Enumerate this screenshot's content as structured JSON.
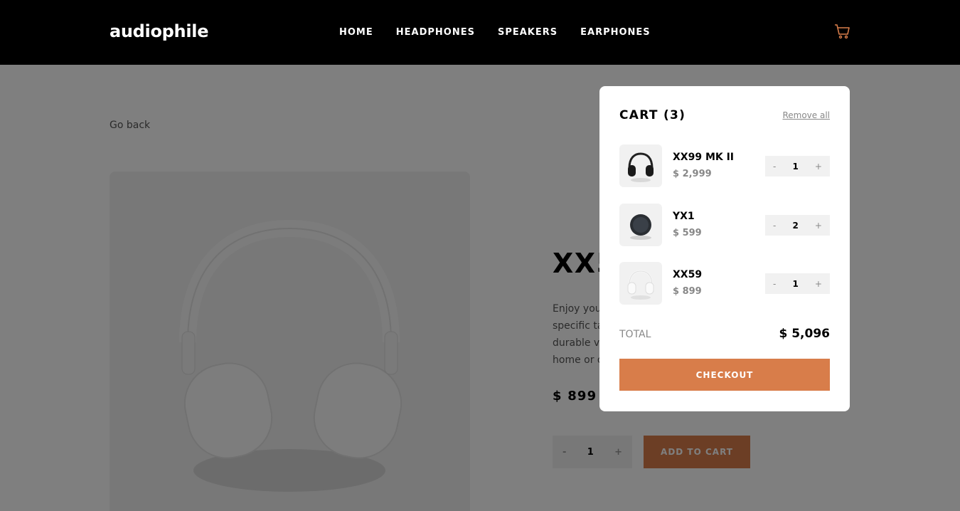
{
  "header": {
    "logo": "audiophile",
    "nav": [
      "HOME",
      "HEADPHONES",
      "SPEAKERS",
      "EARPHONES"
    ],
    "cart_icon": "cart-icon"
  },
  "page": {
    "go_back": "Go back",
    "product_name_visible": "XX5",
    "description_lines": [
      "Enjoy your",
      "specific ta",
      "durable ve",
      "home or o"
    ],
    "price": "$ 899",
    "quantity": "1",
    "minus": "-",
    "plus": "+",
    "add_to_cart": "ADD TO CART"
  },
  "cart": {
    "title": "CART (3)",
    "remove_all": "Remove all",
    "items": [
      {
        "name": "XX99 MK II",
        "price": "$ 2,999",
        "qty": "1",
        "minus": "-",
        "plus": "+"
      },
      {
        "name": "YX1",
        "price": "$ 599",
        "qty": "2",
        "minus": "-",
        "plus": "+"
      },
      {
        "name": "XX59",
        "price": "$ 899",
        "qty": "1",
        "minus": "-",
        "plus": "+"
      }
    ],
    "total_label": "TOTAL",
    "total_value": "$ 5,096",
    "checkout": "CHECKOUT"
  },
  "colors": {
    "accent": "#d87d4a",
    "header_bg": "#000000",
    "light_bg": "#f1f1f1"
  }
}
